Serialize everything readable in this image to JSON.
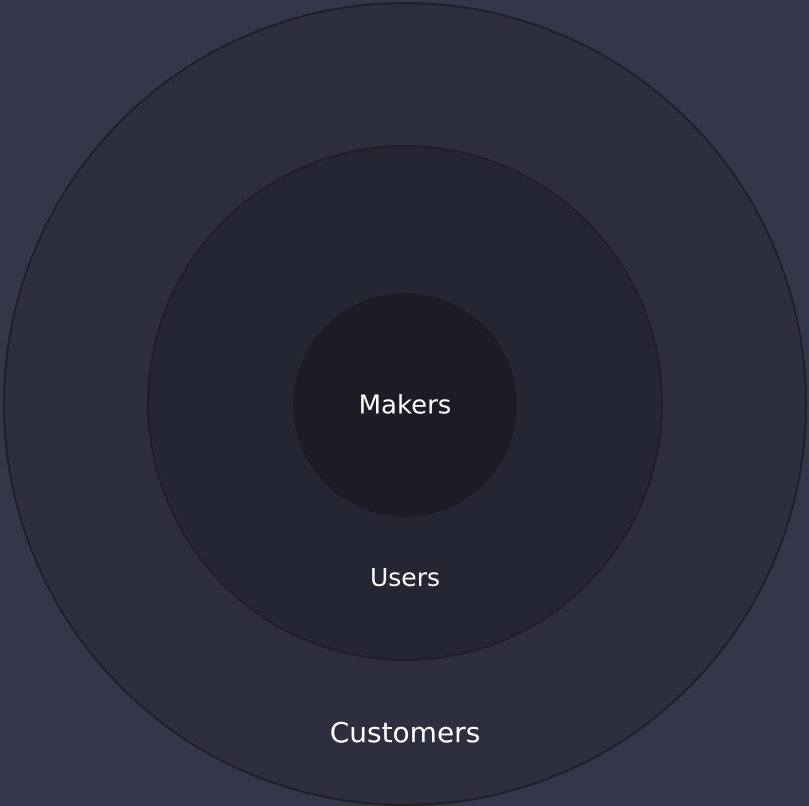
{
  "colors": {
    "background": "#343649",
    "outer_ring": "#2d2f3f",
    "middle_ring": "#242633",
    "inner_circle": "#1b1c25",
    "ring_stroke": "#1e1f2a",
    "label": "#ffffff"
  },
  "rings": {
    "outer": {
      "label": "Customers"
    },
    "middle": {
      "label": "Users"
    },
    "inner": {
      "label": "Makers"
    }
  }
}
